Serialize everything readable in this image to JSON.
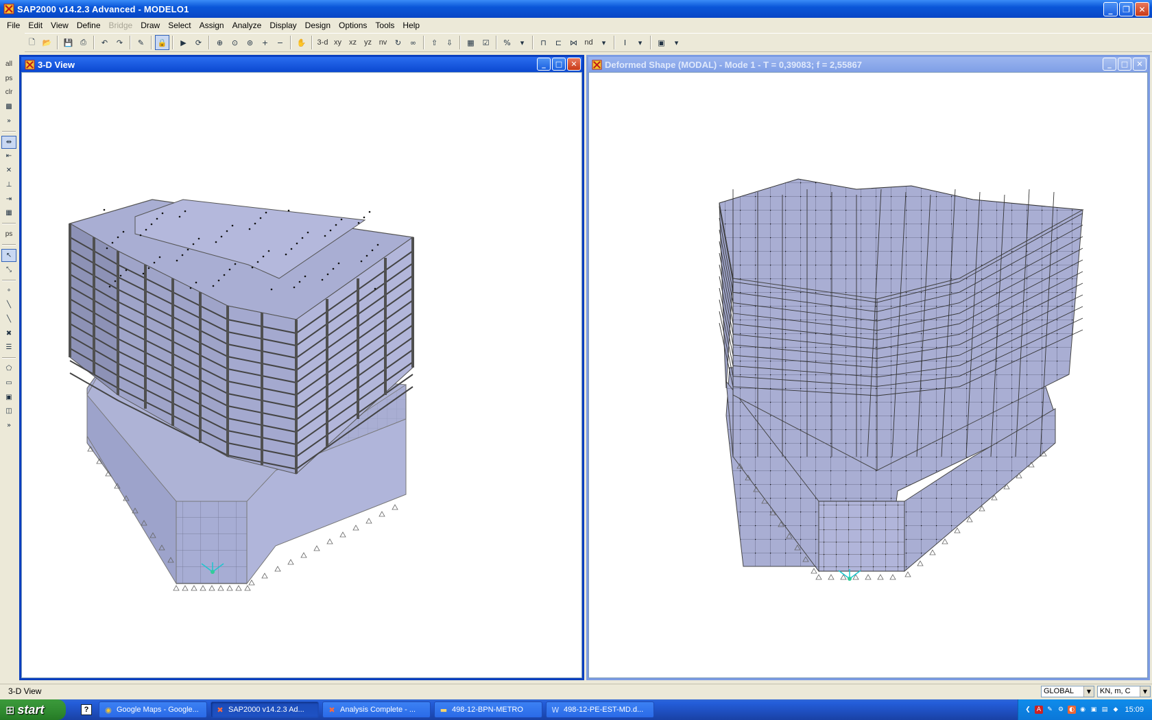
{
  "app": {
    "title": "SAP2000 v14.2.3 Advanced  - MODELO1",
    "window_controls": [
      "_",
      "❐",
      "✕"
    ]
  },
  "menu": [
    {
      "label": "File",
      "enabled": true
    },
    {
      "label": "Edit",
      "enabled": true
    },
    {
      "label": "View",
      "enabled": true
    },
    {
      "label": "Define",
      "enabled": true
    },
    {
      "label": "Bridge",
      "enabled": false
    },
    {
      "label": "Draw",
      "enabled": true
    },
    {
      "label": "Select",
      "enabled": true
    },
    {
      "label": "Assign",
      "enabled": true
    },
    {
      "label": "Analyze",
      "enabled": true
    },
    {
      "label": "Display",
      "enabled": true
    },
    {
      "label": "Design",
      "enabled": true
    },
    {
      "label": "Options",
      "enabled": true
    },
    {
      "label": "Tools",
      "enabled": true
    },
    {
      "label": "Help",
      "enabled": true
    }
  ],
  "toolbar": {
    "view_3d": "3-d",
    "view_xy": "xy",
    "view_xz": "xz",
    "view_yz": "yz",
    "view_nv": "nv",
    "named_display": "nd"
  },
  "left_toolbar": {
    "all": "all",
    "ps": "ps",
    "clr": "clr",
    "ps2": "ps"
  },
  "windows": [
    {
      "title": "3-D View",
      "active": true
    },
    {
      "title": "Deformed Shape (MODAL) - Mode 1 - T = 0,39083;  f = 2,55867",
      "active": false
    }
  ],
  "status": {
    "text": "3-D View",
    "coord_system": "GLOBAL",
    "units": "KN, m, C"
  },
  "taskbar": {
    "start_label": "start",
    "quick_launch": "?",
    "tasks": [
      {
        "label": "Google Maps - Google...",
        "icon": "chrome-icon",
        "active": false
      },
      {
        "label": "SAP2000 v14.2.3 Ad...",
        "icon": "sap-icon",
        "active": true
      },
      {
        "label": "Analysis Complete - ...",
        "icon": "sap-icon",
        "active": false
      },
      {
        "label": "498-12-BPN-METRO",
        "icon": "folder-icon",
        "active": false
      },
      {
        "label": "498-12-PE-EST-MD.d...",
        "icon": "word-icon",
        "active": false
      }
    ],
    "clock": "15:09"
  },
  "colors": {
    "xp_blue": "#0a56d8",
    "model_fill": "#a9aed3",
    "model_edge": "#555566",
    "axis_cyan": "#1cc6cf"
  }
}
